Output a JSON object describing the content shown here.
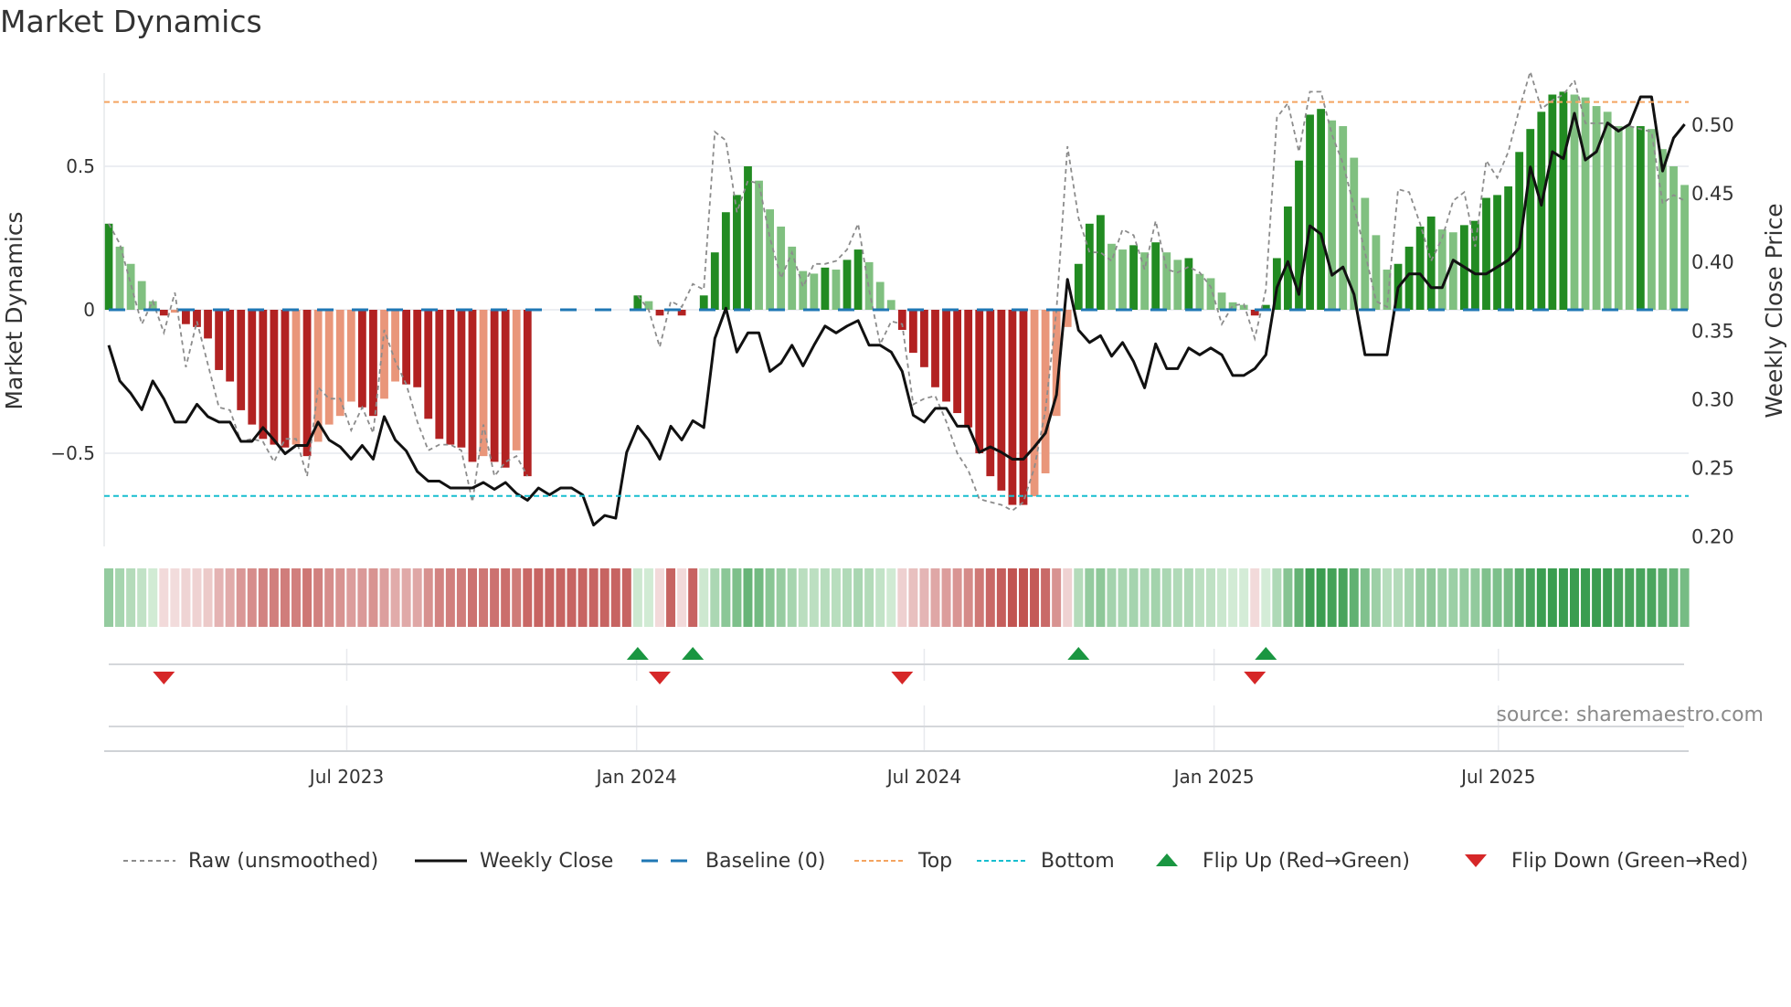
{
  "title": "Market Dynamics",
  "source": "source: sharemaestro.com",
  "legend": [
    {
      "label": "Raw (unsmoothed)",
      "kind": "raw"
    },
    {
      "label": "Weekly Close",
      "kind": "close"
    },
    {
      "label": "Baseline (0)",
      "kind": "baseline"
    },
    {
      "label": "Top",
      "kind": "top"
    },
    {
      "label": "Bottom",
      "kind": "bottom"
    },
    {
      "label": "Flip Up (Red→Green)",
      "kind": "flip_up"
    },
    {
      "label": "Flip Down (Green→Red)",
      "kind": "flip_down"
    }
  ],
  "colors": {
    "pos_strong": "#228b22",
    "pos_weak": "#80c080",
    "neg_strong": "#b22222",
    "neg_weak": "#e9967a",
    "raw": "#8c8c8c",
    "close": "#111111",
    "baseline": "#1f77b4",
    "top": "#f4a460",
    "bottom": "#17becf",
    "flip_up": "#1a9641",
    "flip_down": "#d62728",
    "strip_pos_light": "#d8eeda",
    "strip_pos_dark": "#3a9d50",
    "strip_neg_light": "#f3dede",
    "strip_neg_dark": "#c0504d"
  },
  "chart_data": {
    "type": "bar",
    "title": "Market Dynamics",
    "ylabel": "Market Dynamics",
    "y2label": "Weekly Close Price",
    "ylim": [
      -0.82,
      0.88
    ],
    "y2lim": [
      0.195,
      0.54
    ],
    "y_ticks": [
      {
        "value": 0.5,
        "label": "0.5"
      },
      {
        "value": 0,
        "label": "0"
      },
      {
        "value": -0.5,
        "label": "−0.5"
      }
    ],
    "y2_ticks": [
      {
        "value": 0.2,
        "label": "0.20"
      },
      {
        "value": 0.25,
        "label": "0.25"
      },
      {
        "value": 0.3,
        "label": "0.30"
      },
      {
        "value": 0.35,
        "label": "0.35"
      },
      {
        "value": 0.4,
        "label": "0.40"
      },
      {
        "value": 0.45,
        "label": "0.45"
      },
      {
        "value": 0.5,
        "label": "0.50"
      }
    ],
    "x_ticks": [
      {
        "label": "Jul 2023",
        "week": 21.6
      },
      {
        "label": "Jan 2024",
        "week": 47.9
      },
      {
        "label": "Jul 2024",
        "week": 74.0
      },
      {
        "label": "Jan 2025",
        "week": 100.3
      },
      {
        "label": "Jul 2025",
        "week": 126.1
      }
    ],
    "top_level": 0.724,
    "bottom_level": -0.649,
    "baseline": 0,
    "values": [
      0.3,
      0.22,
      0.16,
      0.1,
      0.03,
      -0.02,
      -0.01,
      -0.05,
      -0.06,
      -0.1,
      -0.21,
      -0.25,
      -0.35,
      -0.4,
      -0.45,
      -0.47,
      -0.48,
      -0.47,
      -0.51,
      -0.46,
      -0.4,
      -0.37,
      -0.32,
      -0.34,
      -0.37,
      -0.31,
      -0.25,
      -0.26,
      -0.27,
      -0.38,
      -0.45,
      -0.47,
      -0.48,
      -0.53,
      -0.51,
      -0.53,
      -0.55,
      -0.49,
      -0.58,
      null,
      null,
      null,
      null,
      null,
      null,
      null,
      null,
      null,
      0.05,
      0.03,
      -0.02,
      null,
      -0.02,
      null,
      0.05,
      0.2,
      0.34,
      0.4,
      0.5,
      0.45,
      0.35,
      0.29,
      0.22,
      0.135,
      0.126,
      0.147,
      0.14,
      0.174,
      0.21,
      0.166,
      0.097,
      0.034,
      -0.07,
      -0.15,
      -0.2,
      -0.27,
      -0.32,
      -0.36,
      -0.41,
      -0.5,
      -0.58,
      -0.63,
      -0.68,
      -0.68,
      -0.65,
      -0.57,
      -0.37,
      -0.06,
      0.16,
      0.3,
      0.33,
      0.23,
      0.21,
      0.225,
      0.2,
      0.235,
      0.2,
      0.174,
      0.18,
      0.125,
      0.11,
      0.06,
      0.026,
      0.017,
      -0.02,
      0.017,
      0.18,
      0.36,
      0.52,
      0.68,
      0.7,
      0.66,
      0.64,
      0.53,
      0.39,
      0.26,
      0.14,
      0.16,
      0.22,
      0.29,
      0.325,
      0.28,
      0.27,
      0.295,
      0.31,
      0.39,
      0.4,
      0.43,
      0.55,
      0.63,
      0.69,
      0.75,
      0.76,
      0.75,
      0.74,
      0.71,
      0.69,
      0.64,
      0.64,
      0.64,
      0.63,
      0.56,
      0.5,
      0.435
    ],
    "strong": [
      1,
      0,
      0,
      0,
      0,
      1,
      0,
      1,
      1,
      1,
      1,
      1,
      1,
      1,
      1,
      1,
      1,
      0,
      1,
      0,
      0,
      0,
      0,
      1,
      1,
      0,
      0,
      1,
      1,
      1,
      1,
      1,
      1,
      1,
      0,
      1,
      1,
      0,
      1,
      1,
      1,
      1,
      1,
      1,
      1,
      1,
      1,
      1,
      1,
      0,
      1,
      1,
      1,
      1,
      1,
      1,
      1,
      1,
      1,
      0,
      0,
      0,
      0,
      0,
      0,
      1,
      0,
      1,
      1,
      0,
      0,
      0,
      1,
      1,
      1,
      1,
      1,
      1,
      1,
      1,
      1,
      1,
      1,
      1,
      0,
      0,
      0,
      0,
      1,
      1,
      1,
      0,
      0,
      1,
      0,
      1,
      0,
      0,
      1,
      0,
      0,
      0,
      0,
      0,
      1,
      1,
      1,
      1,
      1,
      1,
      1,
      0,
      0,
      0,
      0,
      0,
      0,
      1,
      1,
      1,
      1,
      0,
      0,
      1,
      1,
      1,
      1,
      1,
      1,
      1,
      1,
      1,
      1,
      0,
      0,
      0,
      0,
      0,
      0,
      1,
      0,
      0,
      0,
      0
    ],
    "raw": [
      0.3,
      0.23,
      0.09,
      -0.05,
      0.03,
      -0.08,
      0.06,
      -0.2,
      -0.04,
      -0.19,
      -0.34,
      -0.35,
      -0.46,
      -0.45,
      -0.46,
      -0.53,
      -0.45,
      -0.45,
      -0.58,
      -0.27,
      -0.31,
      -0.31,
      -0.42,
      -0.34,
      -0.43,
      -0.07,
      -0.18,
      -0.26,
      -0.39,
      -0.49,
      -0.47,
      -0.47,
      -0.49,
      -0.67,
      -0.4,
      -0.58,
      -0.53,
      -0.51,
      -0.58,
      null,
      null,
      null,
      null,
      null,
      null,
      null,
      null,
      null,
      0.05,
      0.0,
      -0.13,
      0.03,
      0.01,
      0.09,
      0.07,
      0.62,
      0.59,
      0.34,
      0.45,
      0.44,
      0.25,
      0.11,
      0.2,
      0.08,
      0.16,
      0.16,
      0.17,
      0.21,
      0.3,
      0.07,
      -0.12,
      -0.04,
      -0.05,
      -0.33,
      -0.31,
      -0.3,
      -0.39,
      -0.5,
      -0.56,
      -0.66,
      -0.67,
      -0.68,
      -0.7,
      -0.67,
      -0.55,
      -0.35,
      0.0,
      0.57,
      0.32,
      0.2,
      0.2,
      0.17,
      0.28,
      0.26,
      0.14,
      0.31,
      0.14,
      0.13,
      0.15,
      0.13,
      0.08,
      -0.05,
      0.015,
      0.02,
      -0.1,
      0.07,
      0.67,
      0.72,
      0.55,
      0.76,
      0.76,
      0.61,
      0.51,
      0.36,
      0.2,
      0.03,
      0.01,
      0.42,
      0.41,
      0.3,
      0.17,
      0.25,
      0.38,
      0.41,
      0.22,
      0.52,
      0.46,
      0.55,
      0.7,
      0.83,
      0.7,
      0.73,
      0.75,
      0.8,
      0.65,
      0.65,
      0.65,
      0.63,
      0.64,
      0.63,
      0.62,
      0.37,
      0.4,
      0.38
    ],
    "close": [
      0.339,
      0.313,
      0.304,
      0.292,
      0.313,
      0.3,
      0.283,
      0.283,
      0.296,
      0.287,
      0.283,
      0.283,
      0.269,
      0.269,
      0.279,
      0.27,
      0.26,
      0.266,
      0.266,
      0.283,
      0.27,
      0.265,
      0.256,
      0.266,
      0.256,
      0.287,
      0.27,
      0.262,
      0.247,
      0.24,
      0.24,
      0.235,
      0.235,
      0.235,
      0.239,
      0.234,
      0.239,
      0.231,
      0.226,
      0.235,
      0.23,
      0.235,
      0.235,
      0.23,
      0.208,
      0.215,
      0.213,
      0.261,
      0.28,
      0.27,
      0.256,
      0.28,
      0.27,
      0.284,
      0.279,
      0.344,
      0.366,
      0.334,
      0.348,
      0.348,
      0.32,
      0.326,
      0.339,
      0.324,
      0.339,
      0.353,
      0.348,
      0.353,
      0.357,
      0.339,
      0.339,
      0.334,
      0.32,
      0.288,
      0.283,
      0.293,
      0.293,
      0.28,
      0.28,
      0.261,
      0.265,
      0.261,
      0.256,
      0.256,
      0.265,
      0.275,
      0.303,
      0.387,
      0.35,
      0.341,
      0.346,
      0.331,
      0.341,
      0.327,
      0.308,
      0.34,
      0.322,
      0.322,
      0.337,
      0.332,
      0.337,
      0.332,
      0.317,
      0.317,
      0.322,
      0.332,
      0.381,
      0.4,
      0.376,
      0.426,
      0.42,
      0.39,
      0.396,
      0.376,
      0.332,
      0.332,
      0.332,
      0.381,
      0.391,
      0.391,
      0.381,
      0.381,
      0.401,
      0.396,
      0.391,
      0.391,
      0.396,
      0.401,
      0.41,
      0.469,
      0.441,
      0.48,
      0.475,
      0.508,
      0.474,
      0.48,
      0.501,
      0.495,
      0.5,
      0.52,
      0.52,
      0.466,
      0.49,
      0.5
    ],
    "flip_up_weeks": [
      48,
      53,
      88,
      105
    ],
    "flip_down_weeks": [
      5,
      50,
      72,
      104
    ],
    "grid": true,
    "legend_position": "bottom"
  }
}
